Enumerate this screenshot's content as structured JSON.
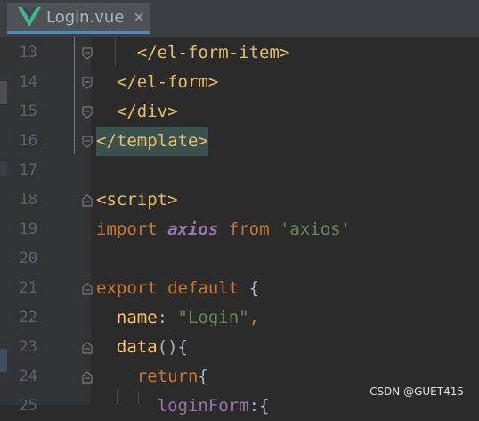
{
  "tab": {
    "title": "Login.vue",
    "close": "✕",
    "icon": "vue-logo-icon"
  },
  "lines": [
    {
      "n": "13",
      "code": "    </el-form-item>"
    },
    {
      "n": "14",
      "code": "  </el-form>"
    },
    {
      "n": "15",
      "code": "  </div>"
    },
    {
      "n": "16",
      "code": "</template>"
    },
    {
      "n": "17",
      "code": ""
    },
    {
      "n": "18",
      "code": "<script>"
    },
    {
      "n": "19",
      "code": "import axios from 'axios'"
    },
    {
      "n": "20",
      "code": ""
    },
    {
      "n": "21",
      "code": "export default {"
    },
    {
      "n": "22",
      "code": "  name: \"Login\","
    },
    {
      "n": "23",
      "code": "  data(){"
    },
    {
      "n": "24",
      "code": "    return{"
    },
    {
      "n": "25",
      "code": "      loginForm:{"
    }
  ],
  "watermark": "CSDN @GUET415",
  "colors": {
    "background": "#2b2b2b",
    "gutter": "#313335",
    "tag": "#e8bf6a",
    "keyword": "#cc7832",
    "string": "#6a8759"
  }
}
